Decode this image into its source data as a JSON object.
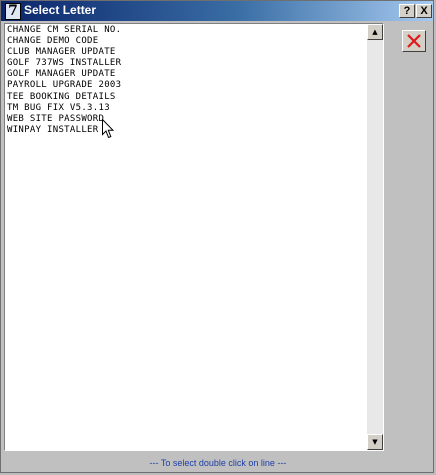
{
  "window": {
    "title": "Select Letter",
    "app_icon_glyph": "7",
    "help_button": "?",
    "close_button": "X"
  },
  "list": {
    "items": [
      "CHANGE CM SERIAL NO.",
      "CHANGE DEMO CODE",
      "CLUB MANAGER UPDATE",
      "GOLF 737WS INSTALLER",
      "GOLF MANAGER UPDATE",
      "PAYROLL UPGRADE 2003",
      "TEE BOOKING DETAILS",
      "TM BUG FIX V5.3.13",
      "WEB SITE PASSWORD",
      "WINPAY INSTALLER"
    ]
  },
  "scrollbar": {
    "up_glyph": "▲",
    "down_glyph": "▼"
  },
  "status": {
    "hint": "---  To select double click on line  ---"
  },
  "colors": {
    "titlebar_start": "#0a246a",
    "titlebar_end": "#a6caf0",
    "close_x": "#e01818",
    "hint_text": "#1c3fa6"
  }
}
